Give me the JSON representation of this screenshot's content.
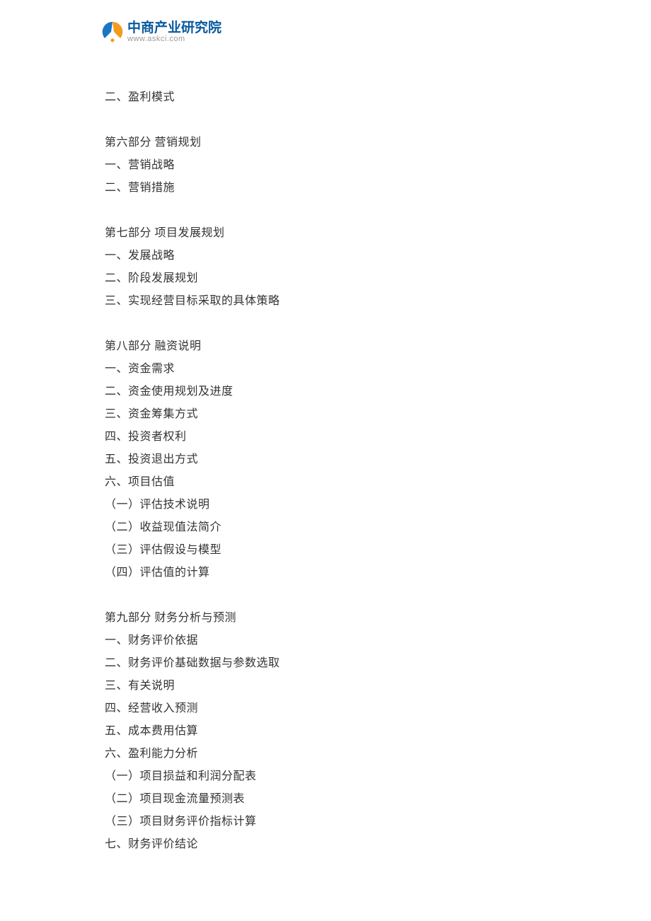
{
  "header": {
    "logo_cn": "中商产业研究院",
    "logo_url": "www.askci.com"
  },
  "content": {
    "intro_item": "二、盈利模式",
    "sections": [
      {
        "title": "第六部分 营销规划",
        "items": [
          "一、营销战略",
          "二、营销措施"
        ]
      },
      {
        "title": "第七部分 项目发展规划",
        "items": [
          "一、发展战略",
          "二、阶段发展规划",
          "三、实现经营目标采取的具体策略"
        ]
      },
      {
        "title": "第八部分 融资说明",
        "items": [
          "一、资金需求",
          "二、资金使用规划及进度",
          "三、资金筹集方式",
          "四、投资者权利",
          "五、投资退出方式",
          "六、项目估值",
          "（一）评估技术说明",
          "（二）收益现值法简介",
          "（三）评估假设与模型",
          "（四）评估值的计算"
        ]
      },
      {
        "title": "第九部分 财务分析与预测",
        "items": [
          "一、财务评价依据",
          "二、财务评价基础数据与参数选取",
          "三、有关说明",
          "四、经营收入预测",
          "五、成本费用估算",
          "六、盈利能力分析",
          "（一）项目损益和利润分配表",
          "（二）项目现金流量预测表",
          "（三）项目财务评价指标计算",
          "七、财务评价结论"
        ]
      }
    ]
  }
}
